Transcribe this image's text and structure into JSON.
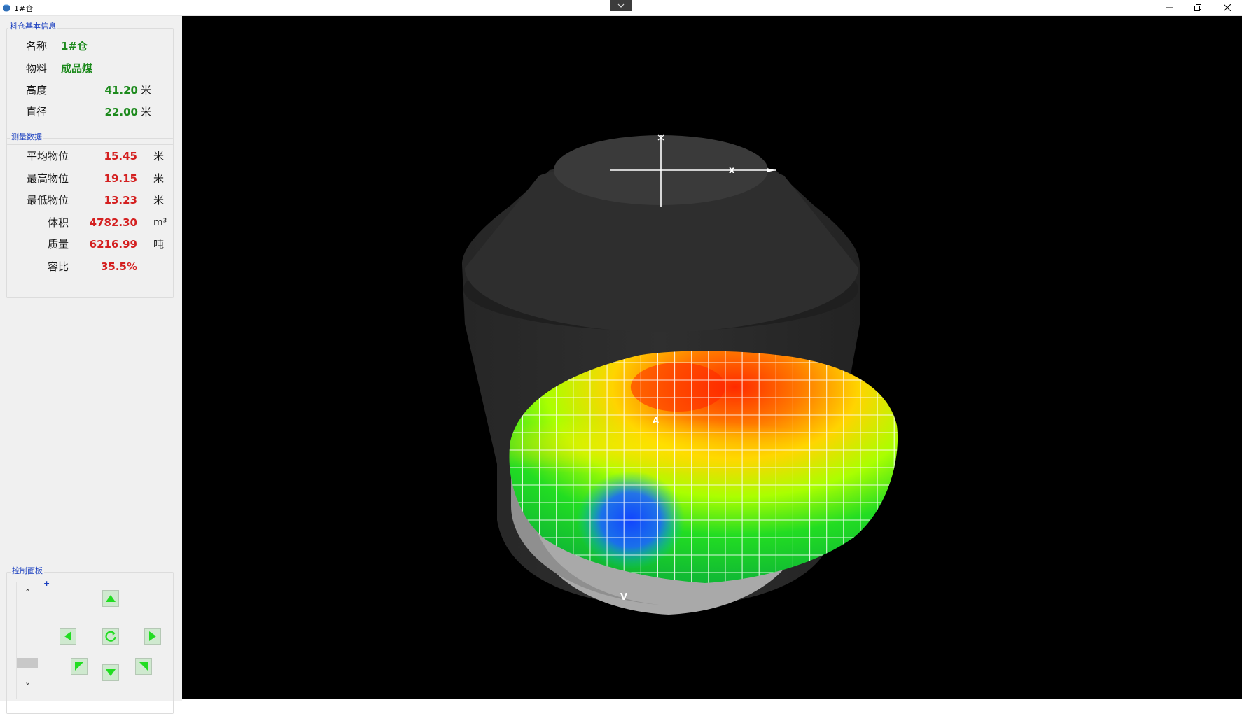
{
  "window": {
    "title": "1#仓"
  },
  "basic_info": {
    "legend": "料仓基本信息",
    "rows": [
      {
        "label": "名称",
        "value": "1#仓",
        "unit": ""
      },
      {
        "label": "物料",
        "value": "成品煤",
        "unit": ""
      },
      {
        "label": "高度",
        "value": "41.20",
        "unit": "米"
      },
      {
        "label": "直径",
        "value": "22.00",
        "unit": "米"
      }
    ]
  },
  "measure": {
    "legend": "测量数据",
    "rows": [
      {
        "label": "平均物位",
        "value": "15.45",
        "unit": "米"
      },
      {
        "label": "最高物位",
        "value": "19.15",
        "unit": "米"
      },
      {
        "label": "最低物位",
        "value": "13.23",
        "unit": "米"
      },
      {
        "label": "体积",
        "value": "4782.30",
        "unit": "m³"
      },
      {
        "label": "质量",
        "value": "6216.99",
        "unit": "吨"
      },
      {
        "label": "容比",
        "value": "35.5%",
        "unit": ""
      }
    ]
  },
  "control": {
    "legend": "控制面板",
    "zoom_plus": "+",
    "zoom_minus": "−",
    "slider_up": "^",
    "slider_down": "⌄"
  },
  "viewport": {
    "axis_x_label": "x",
    "surface_marker_top": "A",
    "surface_marker_bottom": "V"
  },
  "colors": {
    "label_green": "#1d8a1d",
    "value_red": "#d42020",
    "legend_blue": "#1a3fbf",
    "button_arrow": "#22dd22"
  }
}
